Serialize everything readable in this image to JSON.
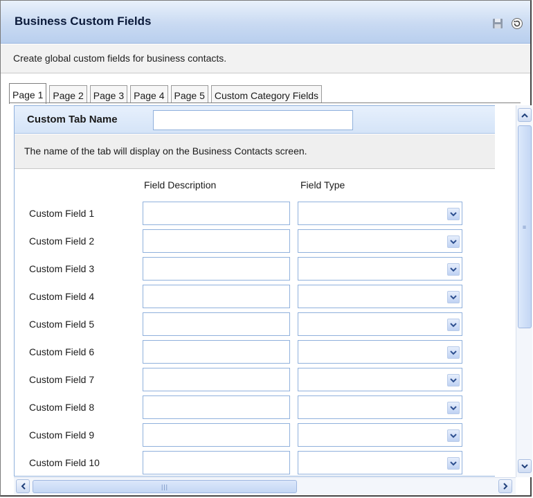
{
  "header": {
    "title": "Business Custom Fields",
    "icons": [
      "save-icon",
      "refresh-icon"
    ]
  },
  "description": "Create global custom fields for business contacts.",
  "tabs": [
    {
      "label": "Page 1",
      "active": true
    },
    {
      "label": "Page 2",
      "active": false
    },
    {
      "label": "Page 3",
      "active": false
    },
    {
      "label": "Page 4",
      "active": false
    },
    {
      "label": "Page 5",
      "active": false
    },
    {
      "label": "Custom Category Fields",
      "active": false
    }
  ],
  "panel": {
    "tab_name_label": "Custom Tab Name",
    "tab_name_value": "",
    "tab_name_note": "The name of the tab will display on the Business Contacts screen.",
    "col_description": "Field Description",
    "col_type": "Field Type",
    "fields": [
      {
        "label": "Custom Field 1",
        "description": "",
        "type": ""
      },
      {
        "label": "Custom Field 2",
        "description": "",
        "type": ""
      },
      {
        "label": "Custom Field 3",
        "description": "",
        "type": ""
      },
      {
        "label": "Custom Field 4",
        "description": "",
        "type": ""
      },
      {
        "label": "Custom Field 5",
        "description": "",
        "type": ""
      },
      {
        "label": "Custom Field 6",
        "description": "",
        "type": ""
      },
      {
        "label": "Custom Field 7",
        "description": "",
        "type": ""
      },
      {
        "label": "Custom Field 8",
        "description": "",
        "type": ""
      },
      {
        "label": "Custom Field 9",
        "description": "",
        "type": ""
      },
      {
        "label": "Custom Field 10",
        "description": "",
        "type": ""
      }
    ]
  },
  "colors": {
    "accent": "#c9daf2",
    "border": "#8fb0dc"
  }
}
